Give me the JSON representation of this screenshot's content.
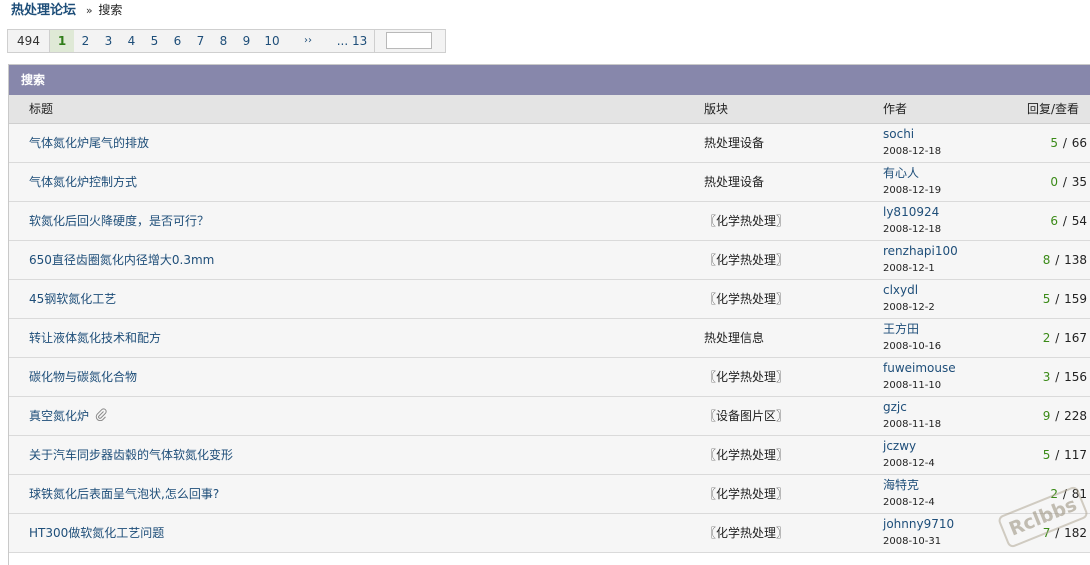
{
  "breadcrumb": {
    "forum": "热处理论坛",
    "sep": "»",
    "current": "搜索"
  },
  "pager": {
    "total": "494",
    "current": "1",
    "pages": [
      "2",
      "3",
      "4",
      "5",
      "6",
      "7",
      "8",
      "9",
      "10"
    ],
    "next": "››",
    "last": "... 13",
    "jump_value": ""
  },
  "section": {
    "title": "搜索"
  },
  "columns": {
    "title": "标题",
    "forum": "版块",
    "author": "作者",
    "stats": "回复/查看"
  },
  "threads": [
    {
      "title": "气体氮化炉尾气的排放",
      "forum": "热处理设备",
      "author": "sochi",
      "date": "2008-12-18",
      "replies": "5",
      "views": "66",
      "attachment": false
    },
    {
      "title": "气体氮化炉控制方式",
      "forum": "热处理设备",
      "author": "有心人",
      "date": "2008-12-19",
      "replies": "0",
      "views": "35",
      "attachment": false
    },
    {
      "title": "软氮化后回火降硬度，是否可行？",
      "forum": "〖化学热处理〗",
      "author": "ly810924",
      "date": "2008-12-18",
      "replies": "6",
      "views": "54",
      "attachment": false
    },
    {
      "title": "650直径齿圈氮化内径增大0.3mm",
      "forum": "〖化学热处理〗",
      "author": "renzhapi100",
      "date": "2008-12-1",
      "replies": "8",
      "views": "138",
      "attachment": false
    },
    {
      "title": "45钢软氮化工艺",
      "forum": "〖化学热处理〗",
      "author": "clxydl",
      "date": "2008-12-2",
      "replies": "5",
      "views": "159",
      "attachment": false
    },
    {
      "title": "转让液体氮化技术和配方",
      "forum": "热处理信息",
      "author": "王方田",
      "date": "2008-10-16",
      "replies": "2",
      "views": "167",
      "attachment": false
    },
    {
      "title": "碳化物与碳氮化合物",
      "forum": "〖化学热处理〗",
      "author": "fuweimouse",
      "date": "2008-11-10",
      "replies": "3",
      "views": "156",
      "attachment": false
    },
    {
      "title": "真空氮化炉",
      "forum": "〖设备图片区〗",
      "author": "gzjc",
      "date": "2008-11-18",
      "replies": "9",
      "views": "228",
      "attachment": true
    },
    {
      "title": "关于汽车同步器齿毂的气体软氮化变形",
      "forum": "〖化学热处理〗",
      "author": "jczwy",
      "date": "2008-12-4",
      "replies": "5",
      "views": "117",
      "attachment": false
    },
    {
      "title": "球铁氮化后表面呈气泡状,怎么回事?",
      "forum": "〖化学热处理〗",
      "author": "海特克",
      "date": "2008-12-4",
      "replies": "2",
      "views": "81",
      "attachment": false
    },
    {
      "title": "HT300做软氮化工艺问题",
      "forum": "〖化学热处理〗",
      "author": "johnny9710",
      "date": "2008-10-31",
      "replies": "7",
      "views": "182",
      "attachment": false
    }
  ],
  "watermark": {
    "text": "Rclbbs"
  },
  "colors": {
    "header_bar": "#8787ab",
    "link": "#1e4e79",
    "reply_count": "#3a8a17",
    "current_page": "#2f7d18"
  }
}
